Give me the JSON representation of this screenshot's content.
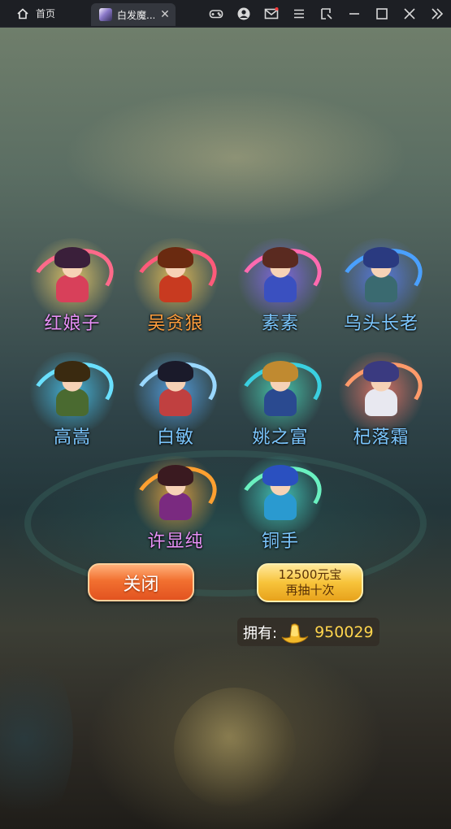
{
  "titlebar": {
    "home_tab_label": "首页",
    "game_tab_label": "白发魔...",
    "close_tab_glyph": "✕",
    "icons": [
      "gamepad-icon",
      "account-icon",
      "mail-icon",
      "menu-icon",
      "screenshot-icon",
      "minimize-icon",
      "maximize-icon",
      "close-window-icon",
      "expand-sidebar-icon"
    ]
  },
  "heroes": [
    {
      "name": "红娘子",
      "name_color": "#e790f6",
      "glow": "#ffd86a",
      "swirl": "#ff6a8a",
      "hair": "#3a1f3a",
      "body": "#d8405a"
    },
    {
      "name": "吴贪狼",
      "name_color": "#ff9e3d",
      "glow": "#ffcc55",
      "swirl": "#ff5a7a",
      "hair": "#6a2a10",
      "body": "#c83a20"
    },
    {
      "name": "素素",
      "name_color": "#7cc7ff",
      "glow": "#8a6aff",
      "swirl": "#ff6ab0",
      "hair": "#5a2a20",
      "body": "#3a50c0"
    },
    {
      "name": "乌头长老",
      "name_color": "#7cc7ff",
      "glow": "#5a80ff",
      "swirl": "#4aa0ff",
      "hair": "#2a3a80",
      "body": "#3a6a70"
    },
    {
      "name": "高嵩",
      "name_color": "#7cc7ff",
      "glow": "#4ad0ff",
      "swirl": "#6ae0ff",
      "hair": "#3a2a10",
      "body": "#4a6a30"
    },
    {
      "name": "白敏",
      "name_color": "#7cc7ff",
      "glow": "#5ab0ff",
      "swirl": "#9ad8ff",
      "hair": "#1a1a2a",
      "body": "#c04040"
    },
    {
      "name": "姚之富",
      "name_color": "#7cc7ff",
      "glow": "#4ae0c0",
      "swirl": "#3ad0e0",
      "hair": "#c08a30",
      "body": "#2a4a90"
    },
    {
      "name": "杞落霜",
      "name_color": "#7cc7ff",
      "glow": "#ff7a6a",
      "swirl": "#ff9a6a",
      "hair": "#3a3a80",
      "body": "#e8e8f0"
    },
    {
      "name": "许显纯",
      "name_color": "#e790f6",
      "glow": "#ffb040",
      "swirl": "#ffa030",
      "hair": "#3a1a20",
      "body": "#7a2a80"
    },
    {
      "name": "铜手",
      "name_color": "#7cc7ff",
      "glow": "#4ae0d0",
      "swirl": "#6af0c0",
      "hair": "#2a50c0",
      "body": "#2a9ad0"
    }
  ],
  "buttons": {
    "close_label": "关闭",
    "draw_cost": "12500元宝",
    "draw_label": "再抽十次"
  },
  "currency": {
    "own_label": "拥有:",
    "icon": "gold-ingot-icon",
    "amount": "950029"
  }
}
